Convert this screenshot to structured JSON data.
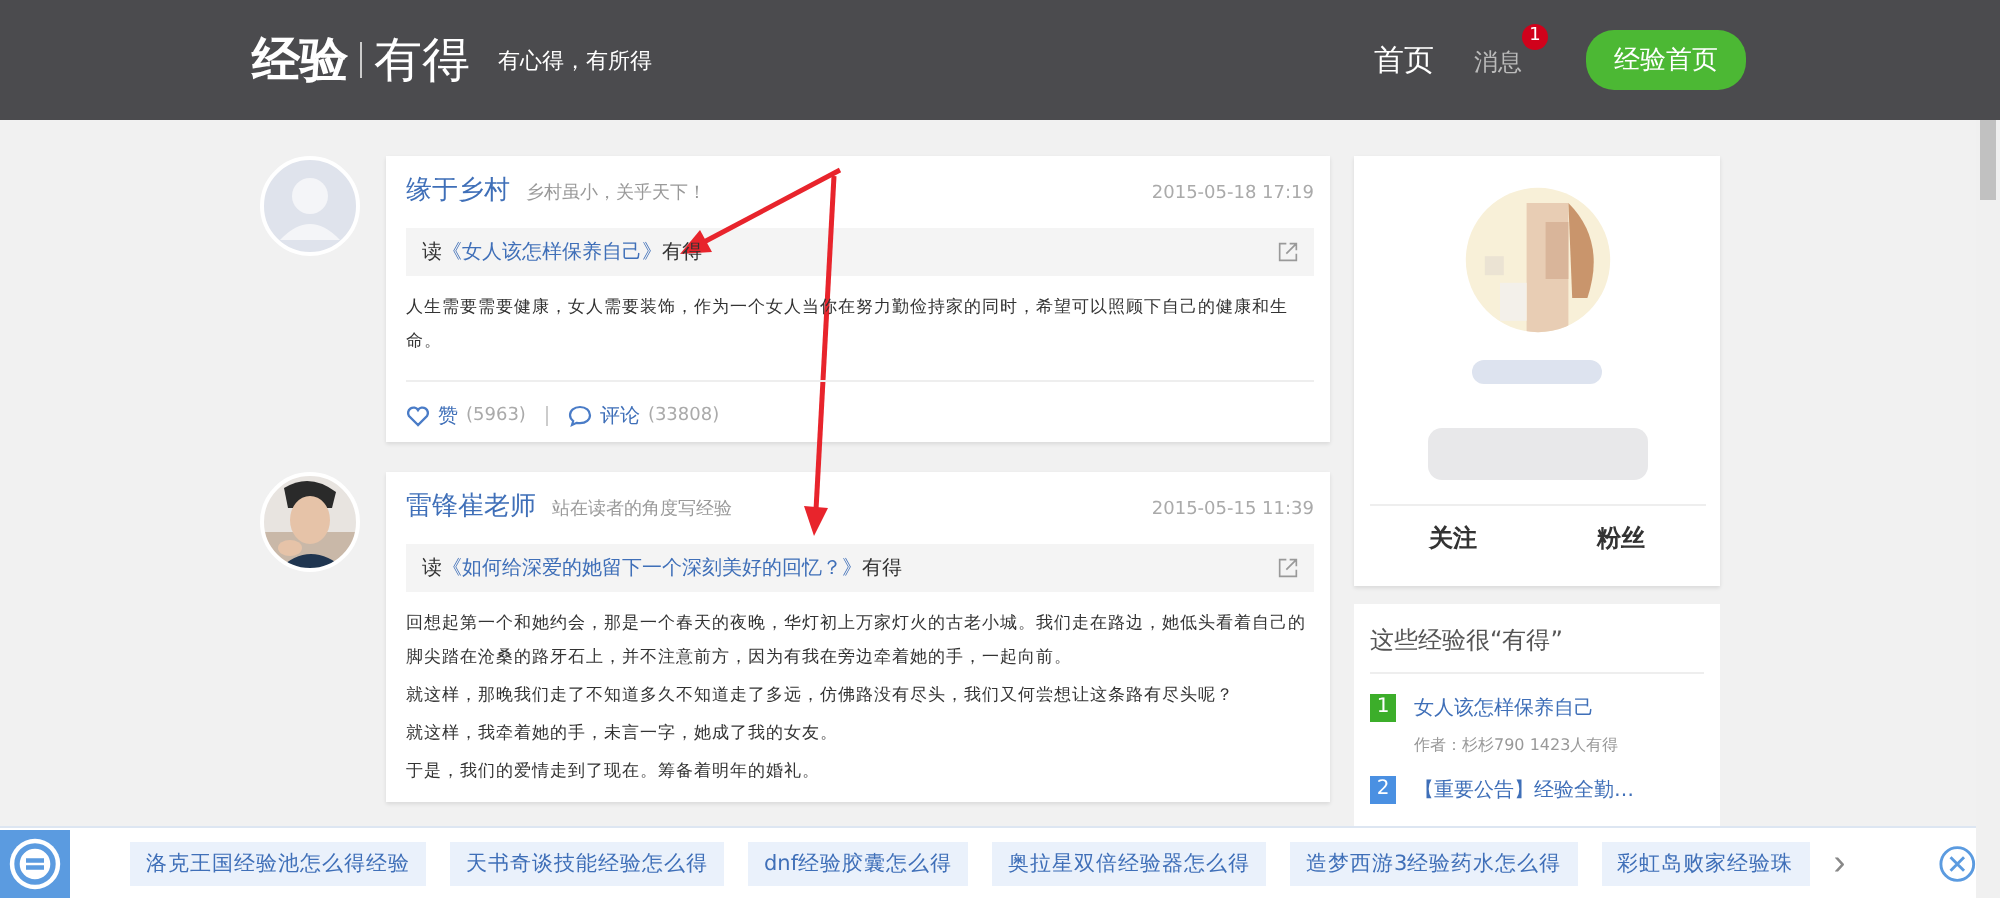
{
  "header": {
    "logo": "经验",
    "logo_sub": "有得",
    "slogan": "有心得，有所得",
    "nav": [
      {
        "label": "首页",
        "selected": true
      },
      {
        "label": "消息",
        "selected": false,
        "badge": "1"
      }
    ],
    "home_button": "经验首页"
  },
  "posts": [
    {
      "kind": "placeholder",
      "author": "缘于乡村",
      "motto": "乡村虽小，关乎天下！",
      "date": "2015-05-18 17:19",
      "read_prefix": "读",
      "article": "《女人该怎样保养自己》",
      "read_suffix": "有得",
      "paragraphs": [
        "人生需要需要健康，女人需要装饰，作为一个女人当你在努力勤俭持家的同时，希望可以照顾下自己的健康和生命。"
      ],
      "likes_label": "赞",
      "likes": "(5963)",
      "comments_label": "评论",
      "comments": "(33808)"
    },
    {
      "author": "雷锋崔老师",
      "motto": "站在读者的角度写经验",
      "date": "2015-05-15 11:39",
      "read_prefix": "读",
      "article": "《如何给深爱的她留下一个深刻美好的回忆？》",
      "read_suffix": "有得",
      "paragraphs": [
        "回想起第一个和她约会，那是一个春天的夜晚，华灯初上万家灯火的古老小城。我们走在路边，她低头看着自己的脚尖踏在沧桑的路牙石上，并不注意前方，因为有我在旁边牵着她的手，一起向前。",
        "就这样，那晚我们走了不知道多久不知道走了多远，仿佛路没有尽头，我们又何尝想让这条路有尽头呢？",
        "就这样，我牵着她的手，未言一字，她成了我的女友。",
        "于是，我们的爱情走到了现在。筹备着明年的婚礼。"
      ]
    }
  ],
  "profile": {
    "stats": [
      "关注",
      "粉丝"
    ]
  },
  "ranking": {
    "title": "这些经验很“有得”",
    "items": [
      {
        "rank": "1",
        "color": "#3cae2a",
        "title": "女人该怎样保养自己",
        "meta": "作者：杉杉790  1423人有得"
      },
      {
        "rank": "2",
        "color": "#4a90e2",
        "title": "【重要公告】经验全勤…"
      }
    ]
  },
  "bottom_bar": {
    "tags": [
      "洛克王国经验池怎么得经验",
      "天书奇谈技能经验怎么得",
      "dnf经验胶囊怎么得",
      "奥拉星双倍经验器怎么得",
      "造梦西游3经验药水怎么得",
      "彩虹岛败家经验珠"
    ],
    "next": "›"
  }
}
